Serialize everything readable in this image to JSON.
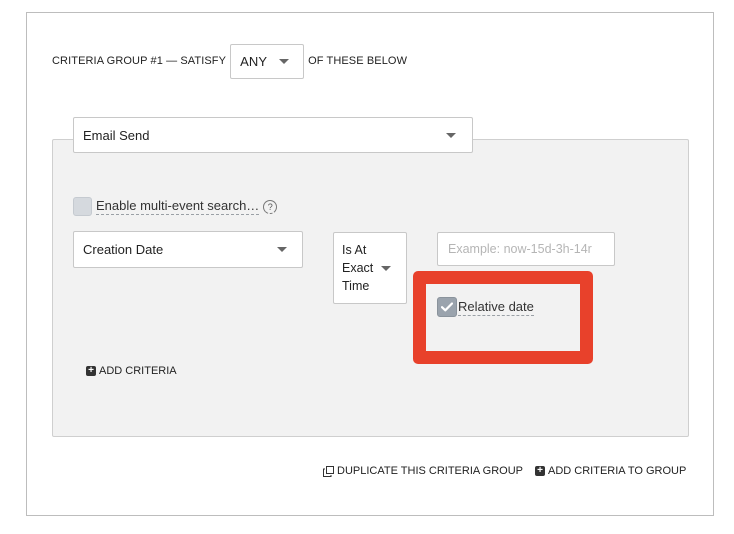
{
  "criteria_group": {
    "prefix": "CRITERIA GROUP #1 — SATISFY",
    "match_value": "ANY",
    "suffix": "OF THESE BELOW"
  },
  "event": {
    "selected": "Email Send"
  },
  "multi_event": {
    "label": "Enable multi-event search…",
    "checked": false,
    "help_icon": "question-circle-icon"
  },
  "criteria": {
    "field": "Creation Date",
    "operator_lines": [
      "Is At",
      "Exact",
      "Time"
    ],
    "value_placeholder": "Example: now-15d-3h-14r",
    "relative_date_label": "Relative date",
    "relative_date_checked": true
  },
  "actions": {
    "add_criteria": "ADD CRITERIA",
    "duplicate_group": "DUPLICATE THIS CRITERIA GROUP",
    "add_to_group": "ADD CRITERIA TO GROUP"
  },
  "colors": {
    "highlight": "#e8412b",
    "panel_bg": "#f2f2f2",
    "checkbox_checked": "#9aa3ad"
  }
}
